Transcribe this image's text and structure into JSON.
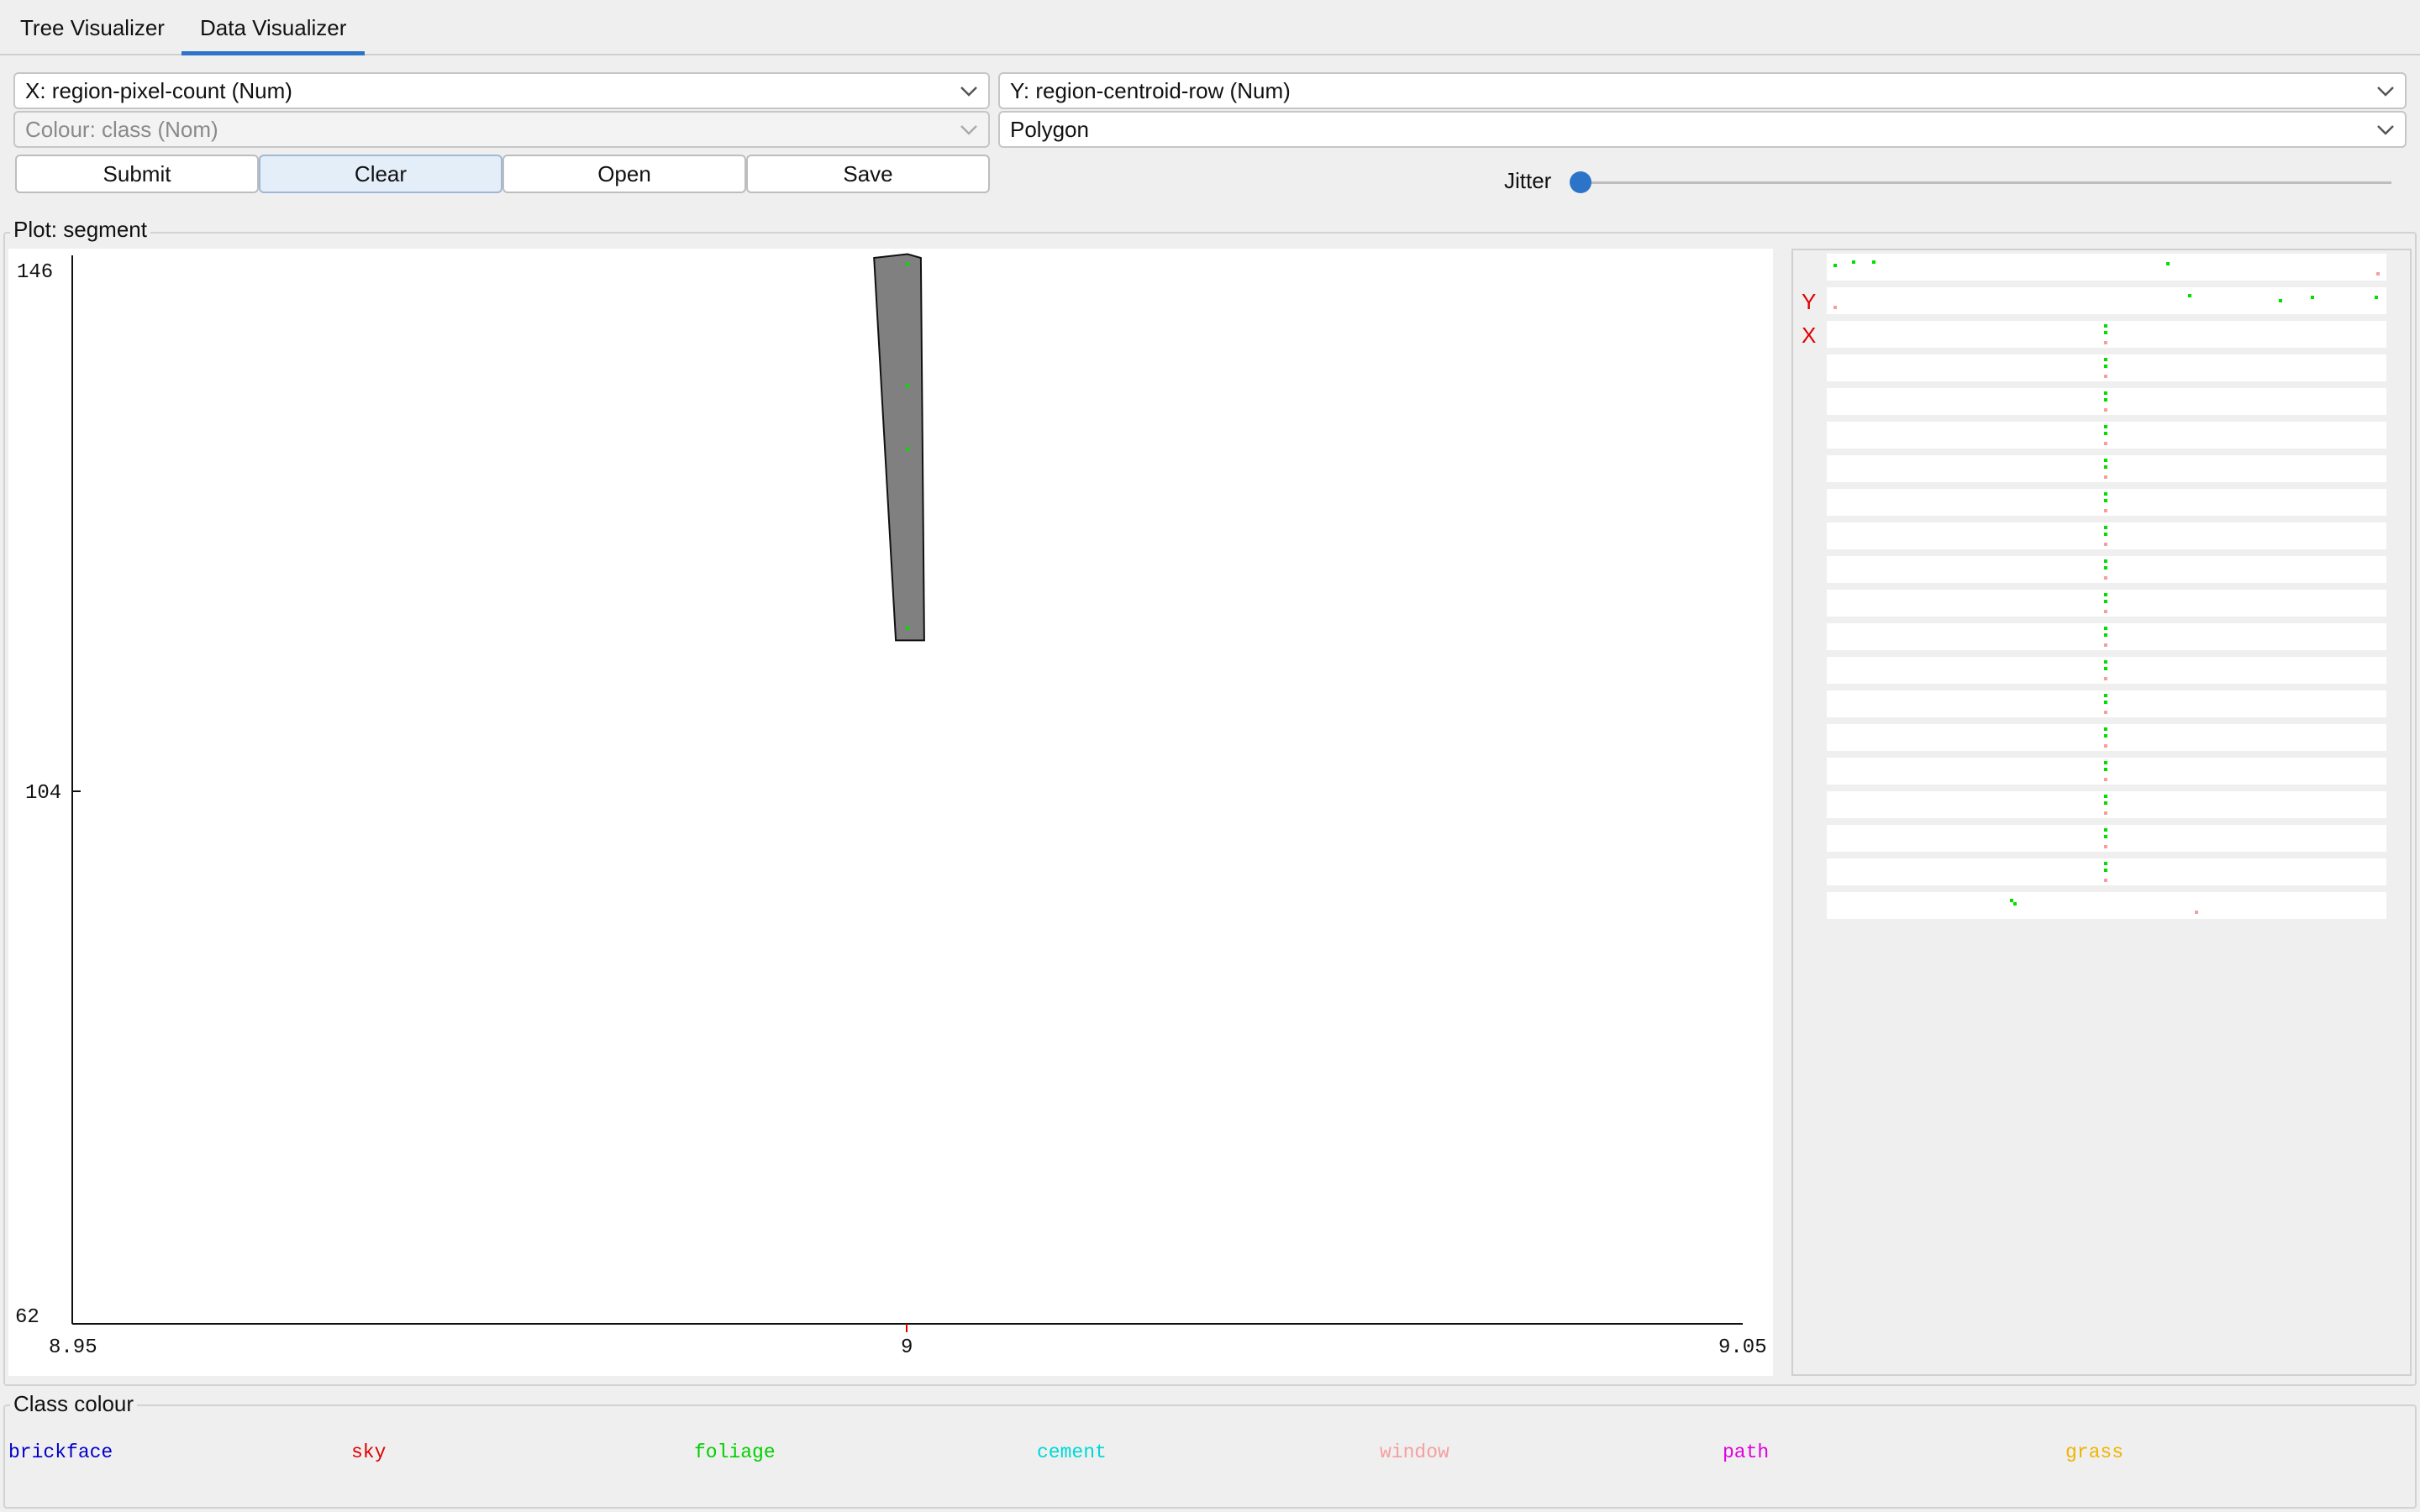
{
  "tabs": [
    {
      "label": "Tree Visualizer",
      "active": false
    },
    {
      "label": "Data Visualizer",
      "active": true
    }
  ],
  "controls": {
    "x_axis": "X: region-pixel-count (Num)",
    "y_axis": "Y: region-centroid-row (Num)",
    "colour": "Colour: class (Nom)",
    "shape": "Polygon",
    "buttons": {
      "submit": "Submit",
      "clear": "Clear",
      "open": "Open",
      "save": "Save"
    },
    "jitter_label": "Jitter",
    "jitter_value": 0
  },
  "plot": {
    "title": "Plot: segment",
    "y_ticks": [
      "146",
      "104",
      "62"
    ],
    "x_ticks": [
      "8.95",
      "9",
      "9.05"
    ],
    "polygon_fill": "#808080",
    "point_color": "#00e000"
  },
  "chart_data": {
    "type": "scatter",
    "xlim": [
      8.95,
      9.05
    ],
    "ylim": [
      62,
      146
    ],
    "xlabel": "",
    "ylabel": "",
    "polygon": [
      [
        8.998,
        145.8
      ],
      [
        9.0,
        146.1
      ],
      [
        9.0008,
        145.8
      ],
      [
        9.001,
        115.0
      ],
      [
        8.9993,
        115.0
      ],
      [
        8.998,
        145.8
      ]
    ],
    "series": [
      {
        "name": "foliage",
        "color": "#00e000",
        "points": [
          [
            9.0,
            145.3
          ],
          [
            9.0,
            135.5
          ],
          [
            9.0,
            130.4
          ],
          [
            9.0,
            116.0
          ]
        ]
      }
    ]
  },
  "matrix": {
    "labels": {
      "y": "Y",
      "x": "X"
    },
    "label_color": "#e00000"
  },
  "class_colour": {
    "title": "Class colour",
    "classes": [
      {
        "name": "brickface",
        "color": "#0000cc"
      },
      {
        "name": "sky",
        "color": "#e00000"
      },
      {
        "name": "foliage",
        "color": "#00d000"
      },
      {
        "name": "cement",
        "color": "#00d8d8"
      },
      {
        "name": "window",
        "color": "#f5a0a0"
      },
      {
        "name": "path",
        "color": "#e000e0"
      },
      {
        "name": "grass",
        "color": "#f0b400"
      }
    ]
  }
}
